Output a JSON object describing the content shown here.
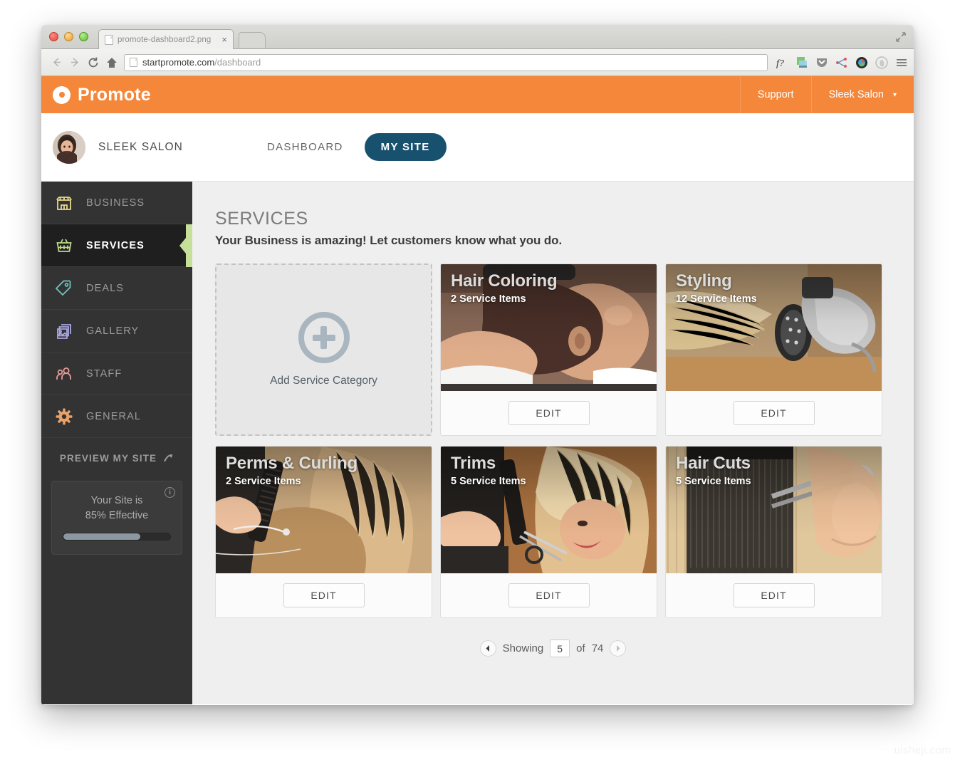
{
  "browser": {
    "tab_title": "promote-dashboard2.png",
    "tab_close": "×",
    "url_host": "startpromote.com",
    "url_path": "/dashboard",
    "extensions": [
      "f-question-icon",
      "download-icon",
      "pocket-icon",
      "share-icon",
      "camera-icon",
      "stop-hand-icon",
      "menu-icon"
    ]
  },
  "topbar": {
    "brand": "Promote",
    "support": "Support",
    "account": "Sleek Salon",
    "caret": "▾"
  },
  "subheader": {
    "business_name": "SLEEK SALON",
    "nav": [
      {
        "label": "DASHBOARD",
        "active": false
      },
      {
        "label": "MY SITE",
        "active": true
      }
    ]
  },
  "sidebar": {
    "items": [
      {
        "label": "BUSINESS",
        "icon": "storefront-icon",
        "active": false
      },
      {
        "label": "SERVICES",
        "icon": "basket-icon",
        "active": true
      },
      {
        "label": "DEALS",
        "icon": "tag-icon",
        "active": false
      },
      {
        "label": "GALLERY",
        "icon": "gallery-icon",
        "active": false
      },
      {
        "label": "STAFF",
        "icon": "staff-icon",
        "active": false
      },
      {
        "label": "GENERAL",
        "icon": "gear-icon",
        "active": false
      }
    ],
    "preview_label": "PREVIEW MY SITE",
    "preview_icon": "external-arrow-icon",
    "effectiveness": {
      "info_icon": "info-icon",
      "line1": "Your Site is",
      "line2": "85% Effective",
      "percent": 72
    }
  },
  "main": {
    "title": "SERVICES",
    "subtitle": "Your Business is amazing! Let customers know what you do.",
    "add_card": {
      "label": "Add Service Category",
      "icon": "plus-circle-icon"
    },
    "cards": [
      {
        "name": "Hair Coloring",
        "count": "2 Service Items",
        "edit": "EDIT"
      },
      {
        "name": "Styling",
        "count": "12 Service Items",
        "edit": "EDIT"
      },
      {
        "name": "Perms & Curling",
        "count": "2 Service Items",
        "edit": "EDIT"
      },
      {
        "name": "Trims",
        "count": "5 Service Items",
        "edit": "EDIT"
      },
      {
        "name": "Hair Cuts",
        "count": "5 Service Items",
        "edit": "EDIT"
      }
    ],
    "pager": {
      "prev_icon": "chevron-left-icon",
      "showing_label": "Showing",
      "current": "5",
      "of_label": "of",
      "total": "74",
      "next_icon": "chevron-right-icon"
    }
  },
  "watermark": "uisheji.com",
  "colors": {
    "brand_orange": "#f4873a",
    "active_blue": "#17516e",
    "active_green": "#c6e09a",
    "sidebar_dark": "#333333"
  }
}
